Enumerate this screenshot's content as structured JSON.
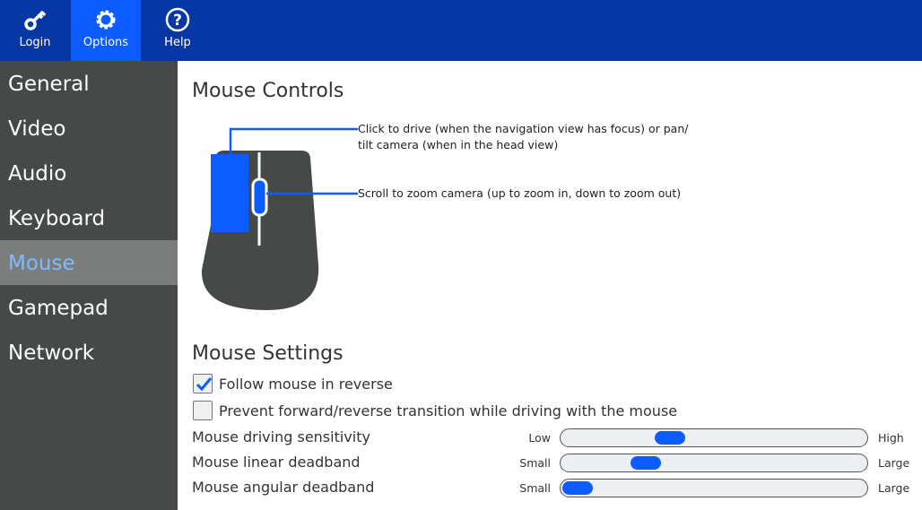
{
  "topbar": {
    "items": [
      {
        "label": "Login",
        "icon": "key-icon"
      },
      {
        "label": "Options",
        "icon": "gear-icon",
        "active": true
      },
      {
        "label": "Help",
        "icon": "help-icon"
      }
    ]
  },
  "sidebar": {
    "items": [
      {
        "label": "General"
      },
      {
        "label": "Video"
      },
      {
        "label": "Audio"
      },
      {
        "label": "Keyboard"
      },
      {
        "label": "Mouse",
        "active": true
      },
      {
        "label": "Gamepad"
      },
      {
        "label": "Network"
      }
    ]
  },
  "controls": {
    "title": "Mouse Controls",
    "callouts": [
      "Click to drive (when the navigation view has focus) or pan/ tilt camera (when in the head view)",
      "Scroll to zoom camera (up to zoom in, down to zoom out)"
    ]
  },
  "settings": {
    "title": "Mouse Settings",
    "checkboxes": [
      {
        "label": "Follow mouse in reverse",
        "checked": true
      },
      {
        "label": "Prevent forward/reverse transition while driving with the mouse",
        "checked": false
      }
    ],
    "sliders": [
      {
        "label": "Mouse driving sensitivity",
        "low": "Low",
        "high": "High",
        "value": 0.34
      },
      {
        "label": "Mouse linear deadband",
        "low": "Small",
        "high": "Large",
        "value": 0.25
      },
      {
        "label": "Mouse angular deadband",
        "low": "Small",
        "high": "Large",
        "value": 0.0
      }
    ]
  },
  "colors": {
    "topbar": "#0737a5",
    "accent": "#0d5cff",
    "sidebar": "#454948",
    "active_text": "#7cbcff"
  }
}
